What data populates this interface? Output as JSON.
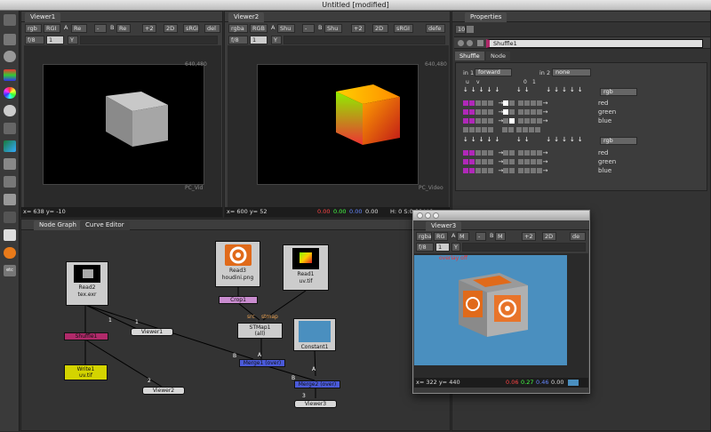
{
  "app": {
    "title": "Untitled [modified]"
  },
  "viewer1": {
    "tab": "Viewer1",
    "ctrls": [
      "rgb",
      "RGI",
      "A",
      "Re",
      "-",
      "B",
      "Re",
      "+2",
      "2D",
      "sRGI",
      "del"
    ],
    "f": "f/8",
    "one": "1",
    "y": "Y",
    "frame_label": "PC_Vid",
    "res": "640,480",
    "status": "x= 638 y= -10"
  },
  "viewer2": {
    "tab": "Viewer2",
    "ctrls": [
      "rgba",
      "RGB",
      "A",
      "Shu",
      "-",
      "B",
      "Shu",
      "+2",
      "2D",
      "sRGI",
      "defe"
    ],
    "f": "f/8",
    "one": "1",
    "y": "Y",
    "frame_label": "PC_Video",
    "res": "640,480",
    "status": "x= 600 y= 52",
    "r": "0.00",
    "g": "0.00",
    "b": "0.00",
    "a": "0.00",
    "h": "H: 0 S:0.00 V:0"
  },
  "properties": {
    "tab": "Properties",
    "counter": "10",
    "node_name": "Shuffle1",
    "tabs": [
      "Shuffle",
      "Node"
    ],
    "in1_label": "in 1",
    "in1_value": "forward",
    "in2_label": "in 2",
    "in2_value": "none",
    "col_u": "u",
    "col_v": "v",
    "col_0": "0",
    "col_1": "1",
    "group1": {
      "layer": "rgb",
      "rows": [
        "red",
        "green",
        "blue"
      ]
    },
    "group2": {
      "layer": "rgb",
      "rows": [
        "red",
        "green",
        "blue"
      ]
    }
  },
  "nodegraph": {
    "tabs": [
      "Node Graph",
      "Curve Editor"
    ],
    "nodes": {
      "read2": "Read2",
      "read2_file": "tex.exr",
      "read3": "Read3",
      "read3_file": "houdini.png",
      "read1": "Read1",
      "read1_file": "uv.tif",
      "crop1": "Crop1",
      "stmap1": "STMap1",
      "stmap1_sub": "(all)",
      "constant1": "Constant1",
      "shuffle1": "Shuffle1",
      "write1": "Write1",
      "write1_file": "uv.tif",
      "merge1": "Merge1 (over)",
      "merge2": "Merge2 (over)",
      "viewer1": "Viewer1",
      "viewer2": "Viewer2",
      "viewer3": "Viewer3"
    },
    "labels": {
      "src": "src",
      "stmap": "stmap",
      "b1": "B",
      "b2": "B",
      "a1": "A",
      "a2": "A",
      "n1": "1",
      "n2": "2",
      "n3": "3",
      "n4": "1"
    }
  },
  "viewer3": {
    "title": "Viewer3",
    "ctrls": [
      "rgba",
      "RG",
      "A",
      "M",
      "-",
      "B",
      "M",
      "+2",
      "2D",
      "de"
    ],
    "f": "f/8",
    "one": "1",
    "y": "Y",
    "overlay": "overlay off",
    "status": "x= 322 y= 440",
    "r": "0.06",
    "g": "0.27",
    "b": "0.46",
    "a": "0.00"
  },
  "colors": {
    "bg": "#2b2b2b",
    "viewer_sky": "#4a8fbf",
    "shuffle_node": "#b02a6a",
    "write_node": "#d4d400",
    "merge_node": "#4a5ad8",
    "crop_node": "#c98ccf"
  }
}
